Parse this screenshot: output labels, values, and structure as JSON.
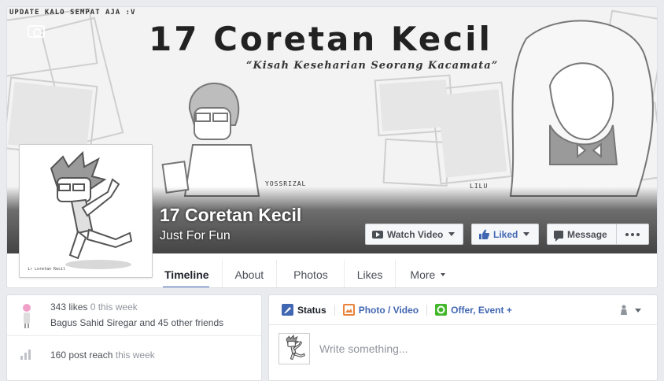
{
  "cover": {
    "update_text": "UPDATE KALO SEMPAT AJA :V",
    "title": "17 Coretan Kecil",
    "subtitle": "“Kisah Keseharian Seorang Kacamata”",
    "signature_left": "YOSSRIZAL",
    "signature_right": "LILU"
  },
  "profile": {
    "caption": "17 Coretan Kecil"
  },
  "page": {
    "name": "17 Coretan Kecil",
    "category": "Just For Fun"
  },
  "actions": {
    "watch_video": "Watch Video",
    "liked": "Liked",
    "message": "Message"
  },
  "tabs": [
    {
      "label": "Timeline"
    },
    {
      "label": "About"
    },
    {
      "label": "Photos"
    },
    {
      "label": "Likes"
    },
    {
      "label": "More"
    }
  ],
  "stats": {
    "likes": "343 likes",
    "likes_week": "0 this week",
    "friends": "Bagus Sahid Siregar and 45 other friends",
    "reach": "160 post reach",
    "reach_week": "this week"
  },
  "composer": {
    "status": "Status",
    "photo_video": "Photo / Video",
    "offer_event": "Offer, Event +",
    "placeholder": "Write something..."
  },
  "colors": {
    "brand_blue": "#4267b2",
    "photo_orange": "#e9823b",
    "offer_green": "#42b72a"
  }
}
